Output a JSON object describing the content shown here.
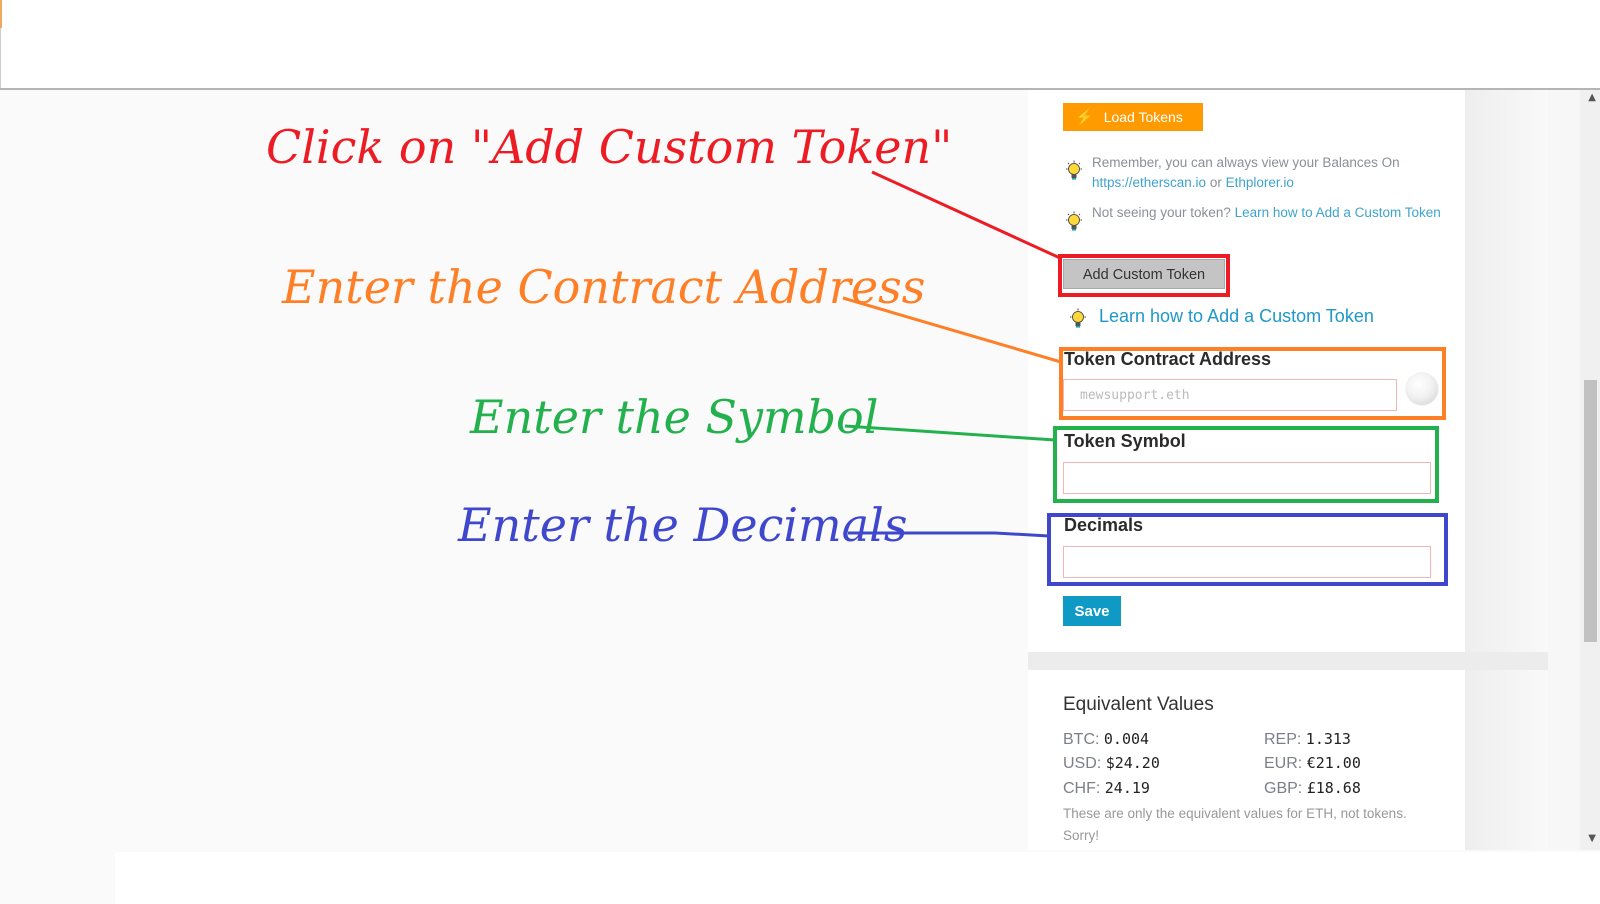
{
  "token_panel": {
    "load_tokens_label": "Load Tokens",
    "load_tokens_icon": "lightning-icon",
    "tips": [
      {
        "text": "Remember, you can always view your Balances On ",
        "link1": "https://etherscan.io",
        "mid": " or ",
        "link2": "Ethplorer.io"
      },
      {
        "text": "Not seeing your token? ",
        "link1": "Learn how to Add a Custom Token"
      }
    ],
    "add_custom_token_label": "Add Custom Token",
    "learn_link": "Learn how to Add a Custom Token",
    "fields": {
      "contract_address": {
        "label": "Token Contract Address",
        "placeholder": "mewsupport.eth",
        "value": ""
      },
      "symbol": {
        "label": "Token Symbol",
        "placeholder": "",
        "value": ""
      },
      "decimals": {
        "label": "Decimals",
        "placeholder": "",
        "value": ""
      }
    },
    "save_label": "Save"
  },
  "equivalent_values": {
    "title": "Equivalent Values",
    "rows": [
      {
        "label": "BTC:",
        "value": "0.004"
      },
      {
        "label": "REP:",
        "value": "1.313"
      },
      {
        "label": "USD:",
        "value": "$24.20"
      },
      {
        "label": "EUR:",
        "value": "€21.00"
      },
      {
        "label": "CHF:",
        "value": "24.19"
      },
      {
        "label": "GBP:",
        "value": "£18.68"
      }
    ],
    "note": "These are only the equivalent values for ETH, not tokens. Sorry!"
  },
  "annotations": {
    "step1": "Click on \"Add Custom Token\"",
    "step2": "Enter the Contract Address",
    "step3": "Enter the Symbol",
    "step4": "Enter the Decimals",
    "colors": {
      "red": "#ed1c24",
      "orange": "#ff7f27",
      "green": "#22b14c",
      "blue": "#3f48cc"
    }
  },
  "colors": {
    "load_tokens": "#ff9a00",
    "save": "#0e9ac4",
    "link": "#1e98c8"
  }
}
